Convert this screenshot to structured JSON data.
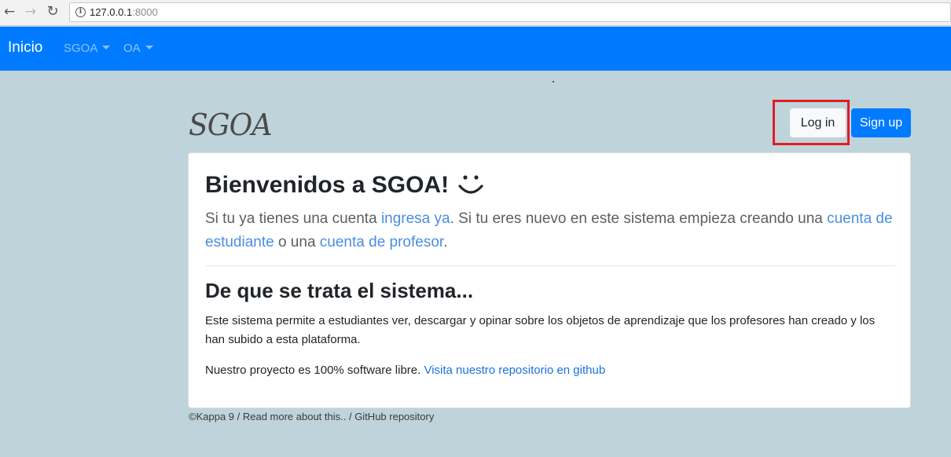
{
  "browser": {
    "back_icon": "arrow-left-icon",
    "forward_icon": "arrow-right-icon",
    "reload_icon": "reload-icon",
    "info_icon": "info-icon",
    "url_host": "127.0.0.1",
    "url_port": ":8000"
  },
  "navbar": {
    "brand": "Inicio",
    "menus": [
      "SGOA",
      "OA"
    ],
    "color": "#007bff"
  },
  "header": {
    "logo": "SGOA",
    "login_label": "Log in",
    "signup_label": "Sign up",
    "highlight_color": "#e41b23"
  },
  "card": {
    "title": "Bienvenidos a SGOA!",
    "lead_1": "Si tu ya tienes una cuenta ",
    "lead_link_1": "ingresa ya",
    "lead_2": ". Si tu eres nuevo en este sistema empieza creando una ",
    "lead_link_2": "cuenta de estudiante",
    "lead_3": " o una ",
    "lead_link_3": "cuenta de profesor",
    "lead_4": ".",
    "subtitle": "De que se trata el sistema...",
    "description": "Este sistema permite a estudiantes ver, descargar y opinar sobre los objetos de aprendizaje que los profesores han creado y los han subido a esta plataforma.",
    "project_text": "Nuestro proyecto es 100% software libre. ",
    "project_link": "Visita nuestro repositorio en github"
  },
  "footer": {
    "text": "©Kappa 9 / Read more about this.. / GitHub repository"
  }
}
